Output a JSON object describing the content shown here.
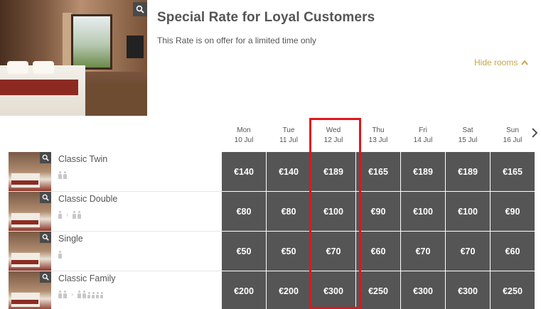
{
  "header": {
    "title": "Special Rate for Loyal Customers",
    "subtitle": "This Rate is on offer for a limited time only",
    "hide_rooms_label": "Hide rooms"
  },
  "days": [
    {
      "dow": "Mon",
      "date": "10 Jul"
    },
    {
      "dow": "Tue",
      "date": "11 Jul"
    },
    {
      "dow": "Wed",
      "date": "12 Jul"
    },
    {
      "dow": "Thu",
      "date": "13 Jul"
    },
    {
      "dow": "Fri",
      "date": "14 Jul"
    },
    {
      "dow": "Sat",
      "date": "15 Jul"
    },
    {
      "dow": "Sun",
      "date": "16 Jul"
    }
  ],
  "rooms": [
    {
      "name": "Classic Twin",
      "occupancy": "2 adults",
      "prices": [
        "€140",
        "€140",
        "€189",
        "€165",
        "€189",
        "€189",
        "€165"
      ]
    },
    {
      "name": "Classic Double",
      "occupancy": "1 adult > 2 adults",
      "prices": [
        "€80",
        "€80",
        "€100",
        "€90",
        "€100",
        "€100",
        "€90"
      ]
    },
    {
      "name": "Single",
      "occupancy": "1 adult",
      "prices": [
        "€50",
        "€50",
        "€70",
        "€60",
        "€70",
        "€70",
        "€60"
      ]
    },
    {
      "name": "Classic Family",
      "occupancy": "2 adults > 2 adults + 4 children",
      "prices": [
        "€200",
        "€200",
        "€300",
        "€250",
        "€300",
        "€300",
        "€250"
      ]
    }
  ],
  "highlighted_day": "Wed",
  "icons": {
    "zoom": "magnifier-icon",
    "hide_rooms": "chevron-up-icon",
    "next": "chevron-right-icon",
    "occupancy": "person-icon"
  },
  "colors": {
    "price_cell": "#555555",
    "accent_link": "#c9a64a",
    "highlight_border": "#e0161f"
  }
}
